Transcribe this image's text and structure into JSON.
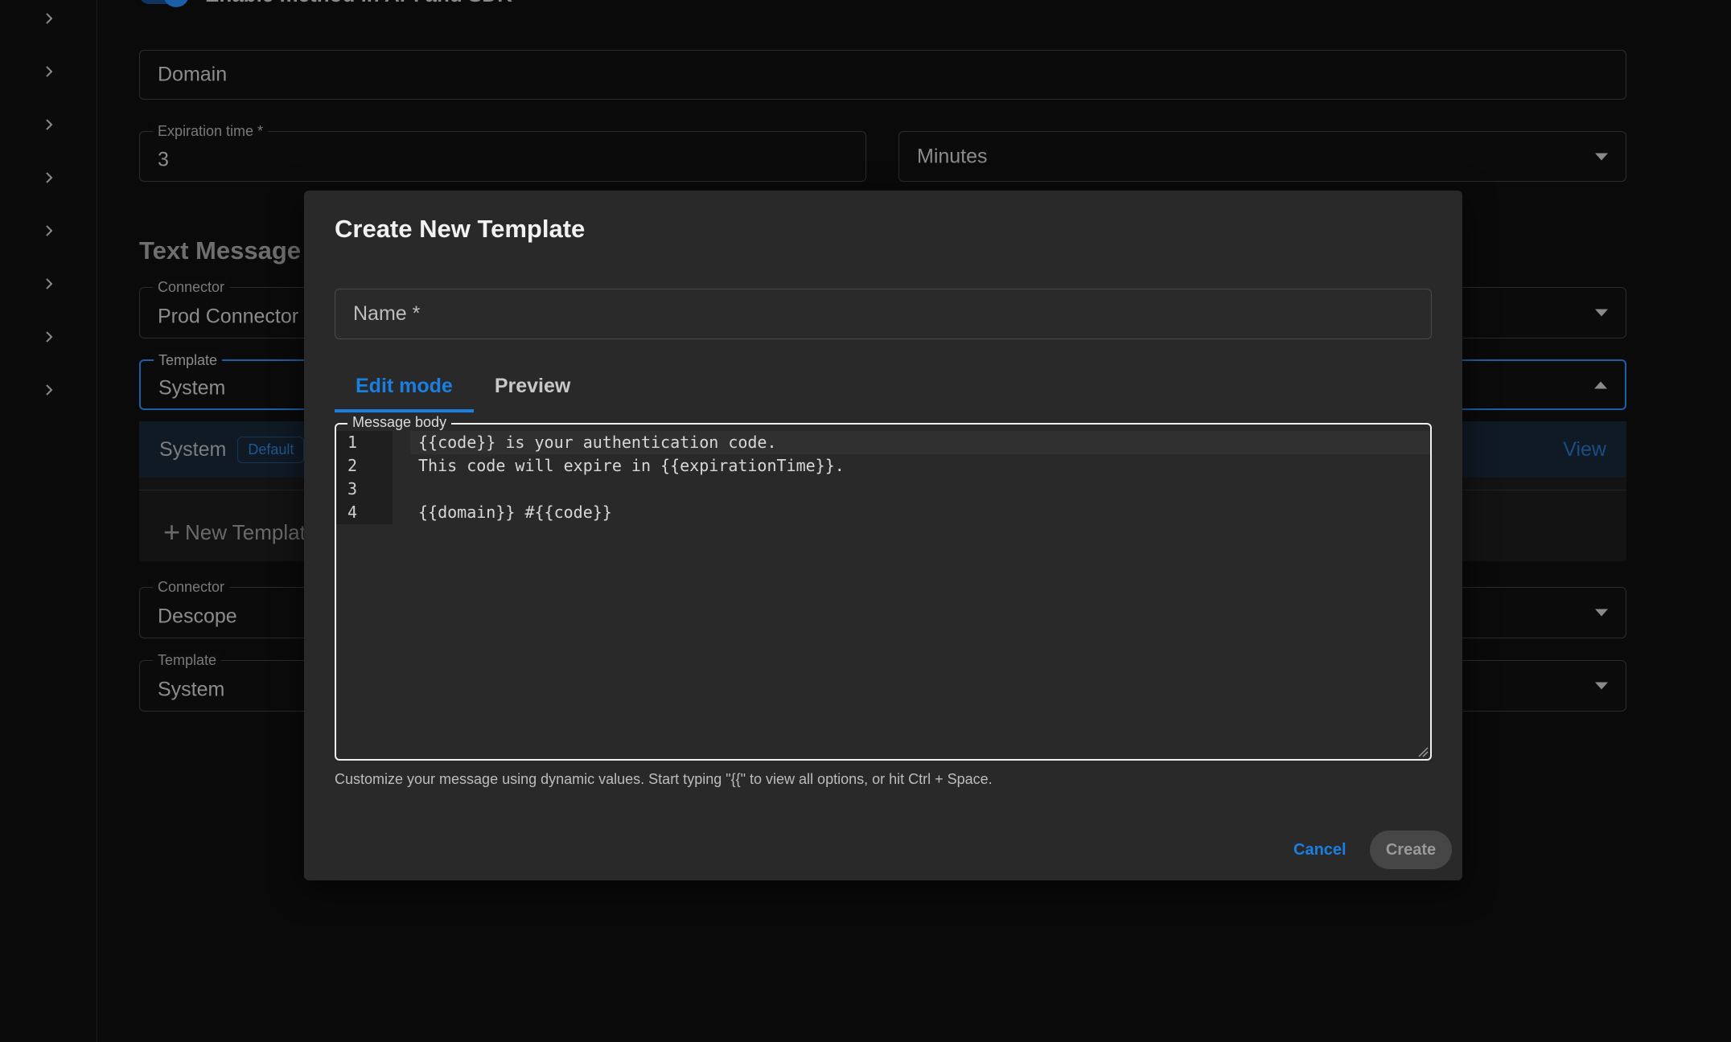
{
  "sidebar": {
    "items": [
      {
        "icon": "chevron-right-icon"
      },
      {
        "icon": "chevron-right-icon"
      },
      {
        "icon": "chevron-right-icon"
      },
      {
        "icon": "chevron-right-icon"
      },
      {
        "icon": "chevron-right-icon"
      },
      {
        "icon": "chevron-right-icon"
      },
      {
        "icon": "chevron-right-icon"
      },
      {
        "icon": "chevron-right-icon"
      }
    ]
  },
  "form": {
    "toggle_label": "Enable method in API and SDK",
    "toggle_on": true,
    "domain": {
      "placeholder": "Domain",
      "value": ""
    },
    "expiration": {
      "label": "Expiration time *",
      "value": "3"
    },
    "expiration_unit": {
      "value": "Minutes"
    },
    "section_title": "Text Message",
    "connector1": {
      "label": "Connector",
      "value": "Prod Connector"
    },
    "template1": {
      "label": "Template",
      "value": "System"
    },
    "dropdown": {
      "option_name": "System",
      "option_badge": "Default",
      "option_action": "View",
      "new_template": "New Template",
      "new_template_icon": "plus-icon"
    },
    "connector2": {
      "label": "Connector",
      "value": "Descope"
    },
    "template2": {
      "label": "Template",
      "value": "System"
    }
  },
  "modal": {
    "title": "Create New Template",
    "name_field": {
      "placeholder": "Name *",
      "value": ""
    },
    "tabs": [
      {
        "label": "Edit mode",
        "active": true
      },
      {
        "label": "Preview",
        "active": false
      }
    ],
    "message_body": {
      "label": "Message body",
      "lines": [
        {
          "number": "1",
          "text": "{{code}} is your authentication code."
        },
        {
          "number": "2",
          "text": "This code will expire in {{expirationTime}}."
        },
        {
          "number": "3",
          "text": ""
        },
        {
          "number": "4",
          "text": "{{domain}} #{{code}}"
        }
      ]
    },
    "helper_text": "Customize your message using dynamic values. Start typing \"{{\" to view all options, or hit Ctrl + Space.",
    "cancel_label": "Cancel",
    "create_label": "Create"
  },
  "colors": {
    "accent": "#1a7fe0",
    "background": "#0a0a0a",
    "modal": "#292929"
  }
}
